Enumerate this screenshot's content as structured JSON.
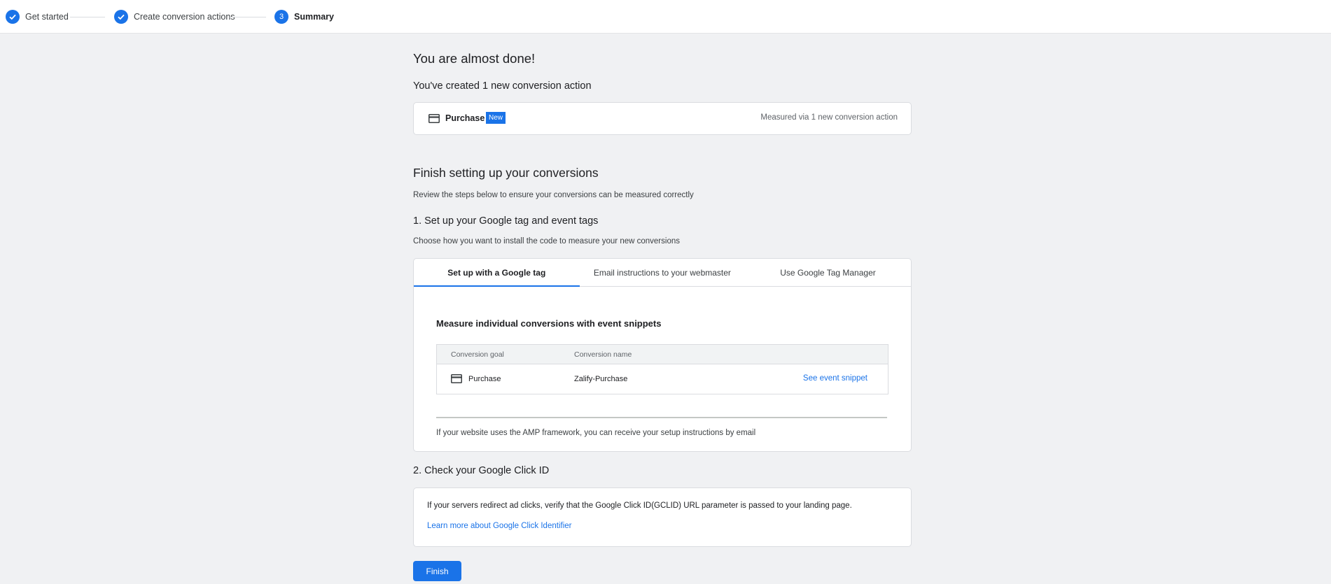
{
  "stepper": {
    "steps": [
      {
        "label": "Get started",
        "state": "done"
      },
      {
        "label": "Create conversion actions",
        "state": "done"
      },
      {
        "label": "Summary",
        "state": "current",
        "number": "3"
      }
    ]
  },
  "summary": {
    "heading": "You are almost done!",
    "created_heading": "You've created 1 new conversion action",
    "purchase_card": {
      "icon": "credit-card-icon",
      "name": "Purchase",
      "badge": "New",
      "measured": "Measured via 1 new conversion action"
    }
  },
  "finish_setup": {
    "heading": "Finish setting up your conversions",
    "description": "Review the steps below to ensure your conversions can be measured correctly",
    "step1": {
      "heading": "1. Set up your Google tag and event tags",
      "description": "Choose how you want to install the code to measure your new conversions",
      "tabs": [
        {
          "label": "Set up with a Google tag",
          "active": true
        },
        {
          "label": "Email instructions to your webmaster",
          "active": false
        },
        {
          "label": "Use Google Tag Manager",
          "active": false
        }
      ],
      "snippets_title": "Measure individual conversions with event snippets",
      "table": {
        "headers": [
          "Conversion goal",
          "Conversion name"
        ],
        "rows": [
          {
            "goal": "Purchase",
            "name": "Zalify-Purchase",
            "action": "See event snippet"
          }
        ]
      },
      "amp_note": "If your website uses the AMP framework, you can receive your setup instructions by email"
    },
    "step2": {
      "heading": "2. Check your Google Click ID",
      "text": "If your servers redirect ad clicks, verify that the Google Click ID(GCLID) URL parameter is passed to your landing page.",
      "link": "Learn more about Google Click Identifier"
    }
  },
  "actions": {
    "finish_label": "Finish"
  },
  "colors": {
    "accent": "#1a73e8",
    "background": "#f0f1f3"
  }
}
